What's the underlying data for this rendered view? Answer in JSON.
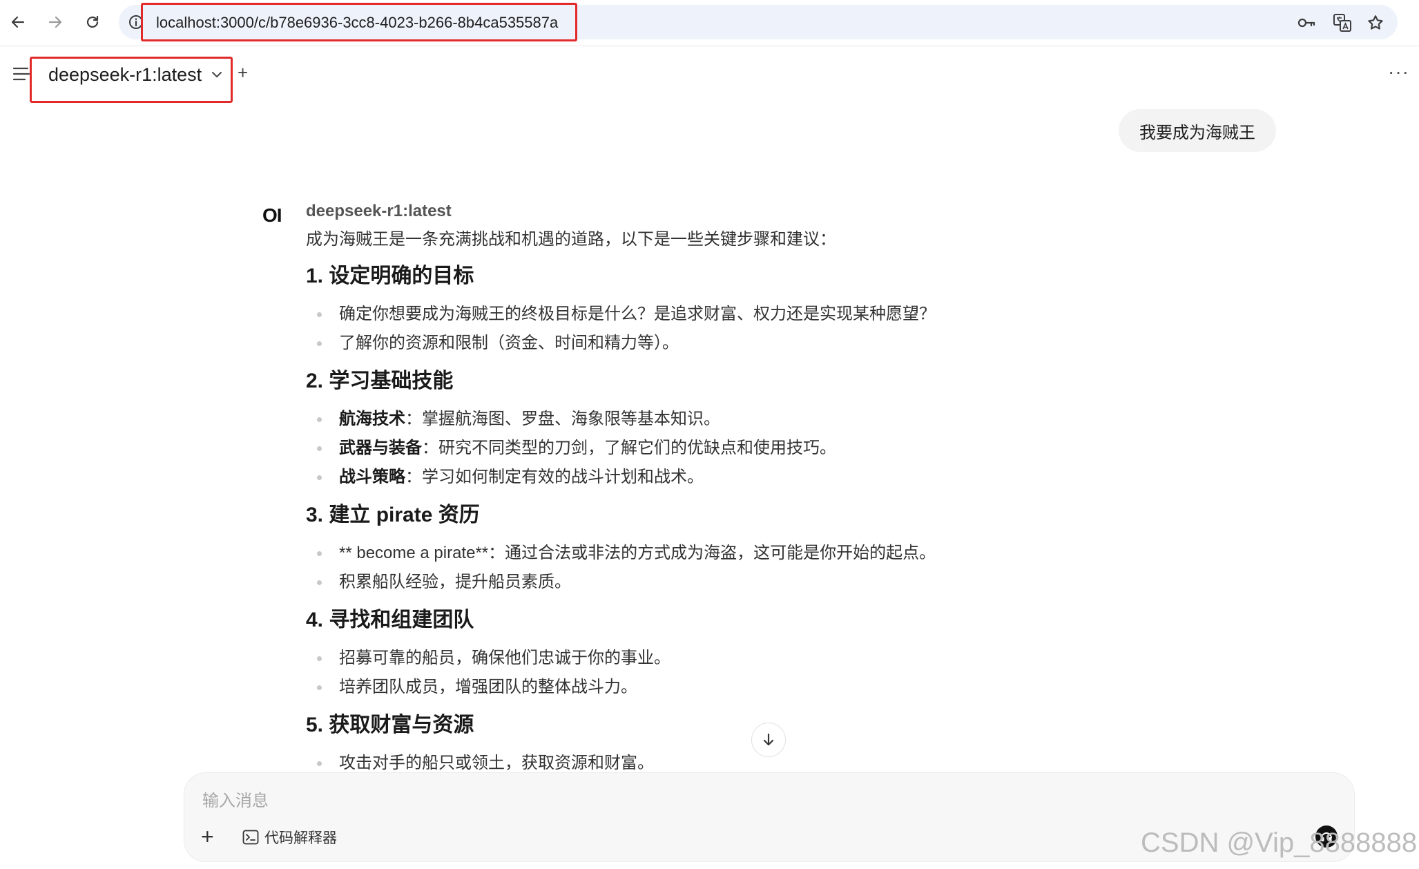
{
  "browser": {
    "url": "localhost:3000/c/b78e6936-3cc8-4023-b266-8b4ca535587a",
    "icons": [
      "back-icon",
      "forward-icon",
      "reload-icon",
      "site-info-icon",
      "key-icon",
      "translate-icon",
      "star-icon"
    ]
  },
  "header": {
    "model_name": "deepseek-r1:latest",
    "add_label": "+",
    "more_label": "···"
  },
  "user_message": "我要成为海贼王",
  "assistant": {
    "avatar": "OI",
    "name": "deepseek-r1:latest",
    "intro": "成为海贼王是一条充满挑战和机遇的道路，以下是一些关键步骤和建议：",
    "sections": [
      {
        "title": "1. 设定明确的目标",
        "items": [
          {
            "bold": "",
            "text": "确定你想要成为海贼王的终极目标是什么？是追求财富、权力还是实现某种愿望？"
          },
          {
            "bold": "",
            "text": "了解你的资源和限制（资金、时间和精力等）。"
          }
        ]
      },
      {
        "title": "2. 学习基础技能",
        "items": [
          {
            "bold": "航海技术",
            "text": "：掌握航海图、罗盘、海象限等基本知识。"
          },
          {
            "bold": "武器与装备",
            "text": "：研究不同类型的刀剑，了解它们的优缺点和使用技巧。"
          },
          {
            "bold": "战斗策略",
            "text": "：学习如何制定有效的战斗计划和战术。"
          }
        ]
      },
      {
        "title": "3. 建立 pirate 资历",
        "items": [
          {
            "bold": "",
            "text": "** become a pirate**：通过合法或非法的方式成为海盗，这可能是你开始的起点。"
          },
          {
            "bold": "",
            "text": "积累船队经验，提升船员素质。"
          }
        ]
      },
      {
        "title": "4. 寻找和组建团队",
        "items": [
          {
            "bold": "",
            "text": "招募可靠的船员，确保他们忠诚于你的事业。"
          },
          {
            "bold": "",
            "text": "培养团队成员，增强团队的整体战斗力。"
          }
        ]
      },
      {
        "title": "5. 获取财富与资源",
        "items": [
          {
            "bold": "",
            "text": "攻击对手的船只或领土，获取资源和财富。"
          }
        ]
      }
    ]
  },
  "composer": {
    "placeholder": "输入消息",
    "value": "",
    "plus_label": "+",
    "code_interpreter_label": "代码解释器"
  },
  "watermark": "CSDN @Vip_8888888",
  "colors": {
    "highlight": "#e32a2a",
    "omnibox_bg": "#eef2fb",
    "bubble_bg": "#f3f3f3"
  }
}
